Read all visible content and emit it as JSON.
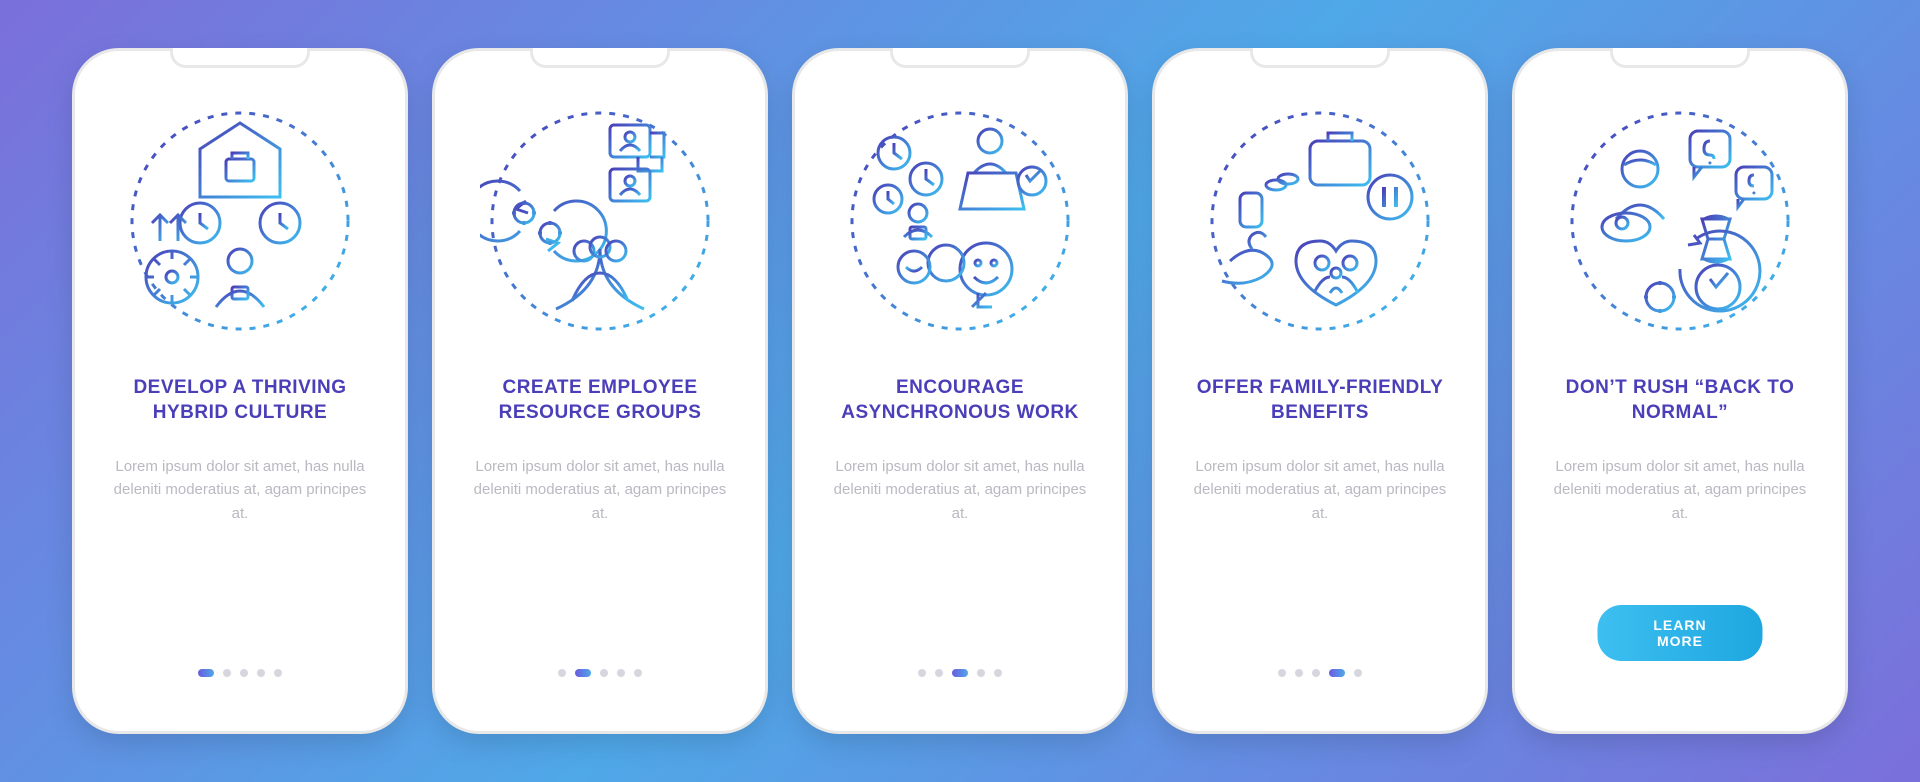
{
  "colors": {
    "grad_start": "#4A3FB8",
    "grad_end": "#3DBFF0",
    "title": "#4A3FB8",
    "desc": "#b9b9c2",
    "dot_inactive": "#d6d6de"
  },
  "lorem": "Lorem ipsum dolor sit amet, has nulla deleniti moderatius at, agam principes at.",
  "screens": [
    {
      "icon": "hybrid-culture-icon",
      "title": "DEVELOP A THRIVING HYBRID CULTURE",
      "active": 0,
      "cta": null
    },
    {
      "icon": "resource-groups-icon",
      "title": "CREATE EMPLOYEE RESOURCE GROUPS",
      "active": 1,
      "cta": null
    },
    {
      "icon": "async-work-icon",
      "title": "ENCOURAGE ASYNCHRONOUS WORK",
      "active": 2,
      "cta": null
    },
    {
      "icon": "family-benefits-icon",
      "title": "OFFER FAMILY-FRIENDLY BENEFITS",
      "active": 3,
      "cta": null
    },
    {
      "icon": "back-to-normal-icon",
      "title": "DON’T RUSH “BACK TO NORMAL”",
      "active": 4,
      "cta": "LEARN MORE"
    }
  ],
  "dot_count": 5
}
